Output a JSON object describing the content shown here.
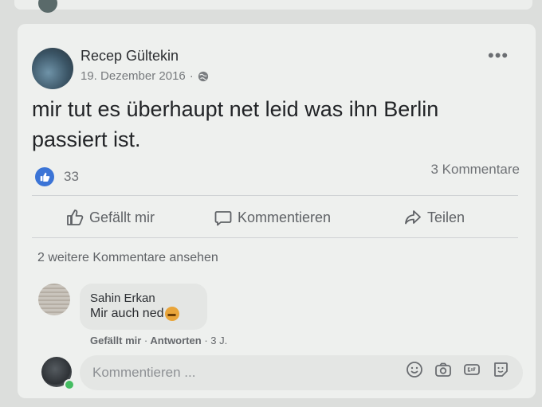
{
  "post": {
    "author": "Recep Gültekin",
    "date": "19. Dezember 2016",
    "meta_sep": "·",
    "more_label": "•••",
    "text": "mir tut es überhaupt net leid was ihn Berlin passiert ist.",
    "like_count": "33",
    "comment_count": "3 Kommentare"
  },
  "actions": {
    "like": "Gefällt mir",
    "comment": "Kommentieren",
    "share": "Teilen"
  },
  "comments": {
    "more_label": "2 weitere Kommentare ansehen",
    "items": [
      {
        "name": "Sahin Erkan",
        "text": "Mir auch ned",
        "like": "Gefällt mir",
        "reply": "Antworten",
        "sep": "·",
        "time": "3 J."
      }
    ]
  },
  "composer": {
    "placeholder": "Kommentieren ..."
  },
  "icons": {
    "like_badge": "thumbs-up-icon",
    "globe": "globe-icon",
    "emoji": "grimacing-emoji",
    "tools": [
      "smiley-icon",
      "camera-icon",
      "gif-icon",
      "sticker-icon"
    ]
  },
  "colors": {
    "accent": "#3b74d6",
    "online": "#45bd62"
  }
}
